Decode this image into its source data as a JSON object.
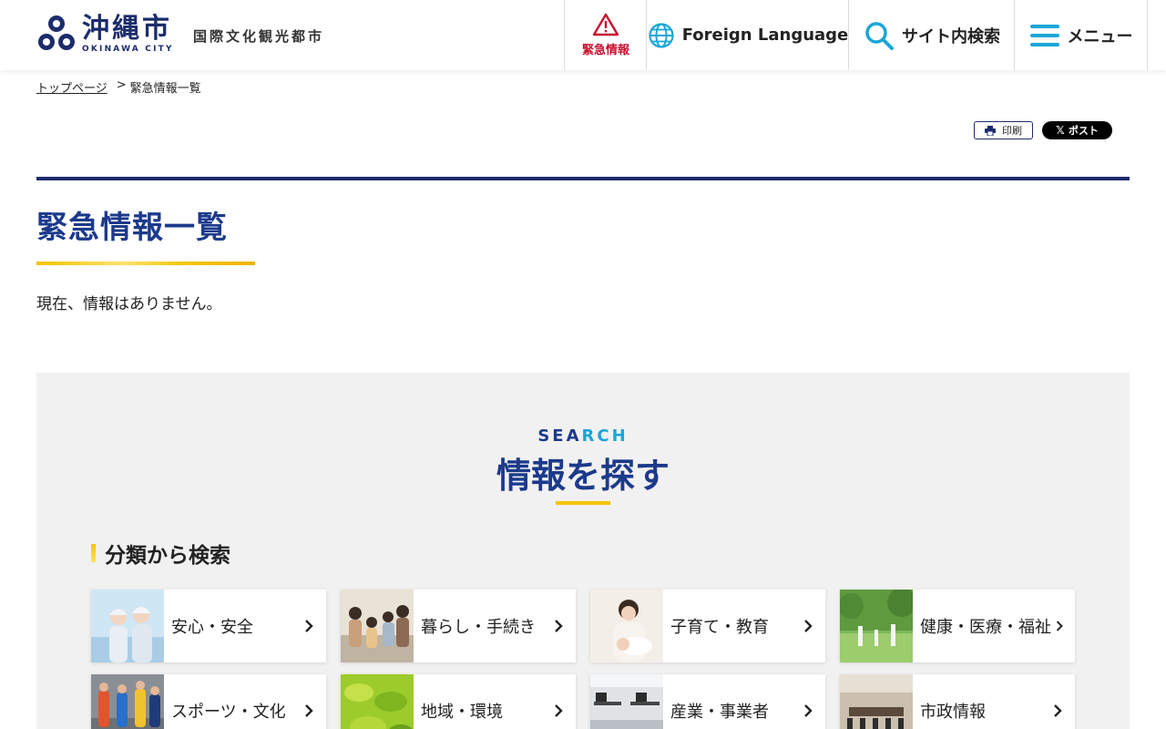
{
  "header": {
    "logo_name": "沖縄市",
    "logo_sub": "OKINAWA CITY",
    "tagline": "国際文化観光都市",
    "emergency_label": "緊急情報",
    "language_label": "Foreign Language",
    "search_label": "サイト内検索",
    "menu_label": "メニュー"
  },
  "breadcrumb": {
    "home": "トップページ",
    "separator": ">",
    "current": "緊急情報一覧"
  },
  "share": {
    "print_label": "印刷",
    "post_label": "ポスト"
  },
  "main": {
    "title": "緊急情報一覧",
    "message": "現在、情報はありません。"
  },
  "search": {
    "en_a": "SEA",
    "en_b": "RCH",
    "title": "情報を探す",
    "category_heading": "分類から検索",
    "categories": [
      {
        "label": "安心・安全",
        "icon": "safety-workers-photo"
      },
      {
        "label": "暮らし・手続き",
        "icon": "family-photo"
      },
      {
        "label": "子育て・教育",
        "icon": "parent-baby-photo"
      },
      {
        "label": "健康・医療・福祉",
        "icon": "park-exercise-photo"
      },
      {
        "label": "スポーツ・文化",
        "icon": "marathon-photo"
      },
      {
        "label": "地域・環境",
        "icon": "green-leaves-photo"
      },
      {
        "label": "産業・事業者",
        "icon": "office-photo"
      },
      {
        "label": "市政情報",
        "icon": "council-room-photo"
      }
    ]
  },
  "colors": {
    "navy": "#1c2c6c",
    "title_blue": "#1c3a8c",
    "accent_yellow": "#f5c400",
    "emergency_red": "#c8102e",
    "icon_blue": "#1aa6d8",
    "section_bg": "#f1f1f1"
  }
}
